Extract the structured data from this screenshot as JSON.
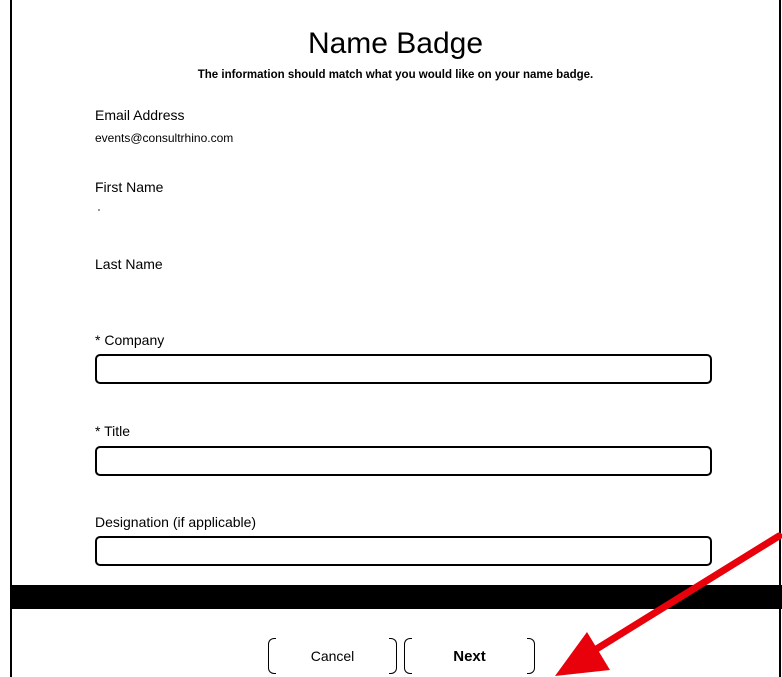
{
  "header": {
    "title": "Name Badge",
    "subtitle": "The information should match what you would like on your name badge."
  },
  "form": {
    "email": {
      "label": "Email Address",
      "value": "events@consultrhino.com"
    },
    "first_name": {
      "label": "First Name",
      "value": ""
    },
    "last_name": {
      "label": "Last Name",
      "value": ""
    },
    "company": {
      "label": "* Company",
      "value": ""
    },
    "title": {
      "label": "* Title",
      "value": ""
    },
    "designation": {
      "label": "Designation (if applicable)",
      "value": ""
    }
  },
  "actions": {
    "cancel_label": "Cancel",
    "next_label": "Next"
  },
  "colors": {
    "annotation_arrow": "#e8000b",
    "divider_bar": "#000000"
  },
  "icons": {
    "annotation": "red-arrow-icon"
  }
}
